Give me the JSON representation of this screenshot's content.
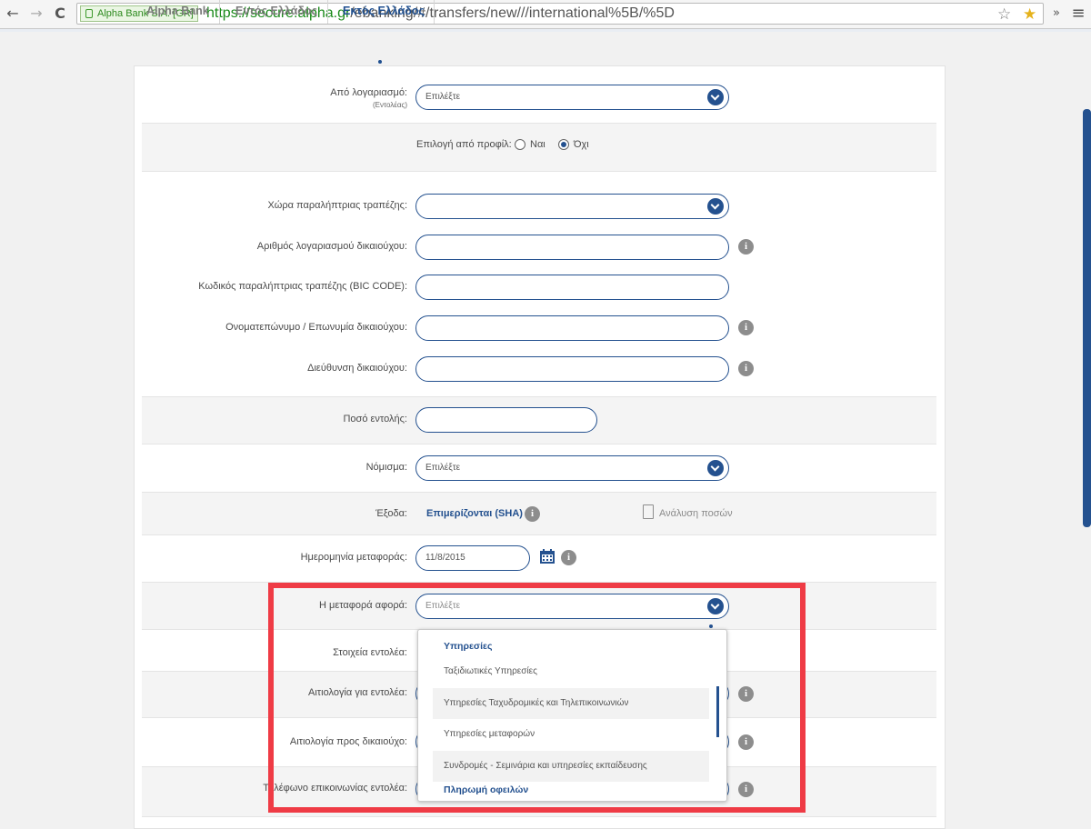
{
  "browser": {
    "back_icon": "←",
    "forward_icon": "→",
    "reload_icon": "C",
    "ev_label": "Alpha Bank S.A. [GR]",
    "url_secure": "https://secure.alpha.gr",
    "url_rest": "/ebanking/#/transfers/new///international%5B/%5D",
    "more_icon": "»",
    "menu_icon": "≡"
  },
  "tabs": [
    {
      "label": "Alpha Bank"
    },
    {
      "label": "Εντός Ελλάδος"
    },
    {
      "label": "Εκτός Ελλάδος"
    }
  ],
  "form": {
    "from_account": {
      "label": "Από λογαριασμό:",
      "sublabel": "(Εντολέας)",
      "value": "Επιλέξτε"
    },
    "profile": {
      "label": "Επιλογή από προφίλ:",
      "yes": "Ναι",
      "no": "Όχι",
      "selected": "no"
    },
    "country": {
      "label": "Χώρα παραλήπτριας τραπέζης:",
      "value": ""
    },
    "account_number": {
      "label": "Αριθμός λογαριασμού δικαιούχου:",
      "value": ""
    },
    "bic": {
      "label": "Κωδικός παραλήπτριας τραπέζης (BIC CODE):",
      "value": ""
    },
    "beneficiary_name": {
      "label": "Ονοματεπώνυμο / Επωνυμία δικαιούχου:",
      "value": ""
    },
    "beneficiary_address": {
      "label": "Διεύθυνση δικαιούχου:",
      "value": ""
    },
    "amount": {
      "label": "Ποσό εντολής:",
      "value": ""
    },
    "currency": {
      "label": "Νόμισμα:",
      "value": "Επιλέξτε"
    },
    "charges": {
      "label": "Έξοδα:",
      "value": "Επιμερίζονται (SHA)",
      "analysis": "Ανάλυση ποσών"
    },
    "date": {
      "label": "Ημερομηνία μεταφοράς:",
      "value": "11/8/2015"
    },
    "purpose": {
      "label": "Η μεταφορά αφορά:",
      "value": "Επιλέξτε"
    },
    "orderer_details": {
      "label": "Στοιχεία εντολέα:"
    },
    "reason_orderer": {
      "label": "Αιτιολογία για εντολέα:"
    },
    "reason_beneficiary": {
      "label": "Αιτιολογία προς δικαιούχο:"
    },
    "phone": {
      "label": "Τηλέφωνο επικοινωνίας εντολέα:"
    },
    "info_icon": "i"
  },
  "dropdown": {
    "group1": "Υπηρεσίες",
    "options": [
      "Ταξιδιωτικές Υπηρεσίες",
      "Υπηρεσίες Ταχυδρομικές και Τηλεπικοινωνιών",
      "Υπηρεσίες μεταφορών",
      "Συνδρομές - Σεμινάρια και υπηρεσίες εκπαίδευσης"
    ],
    "group2": "Πληρωμή οφειλών"
  }
}
